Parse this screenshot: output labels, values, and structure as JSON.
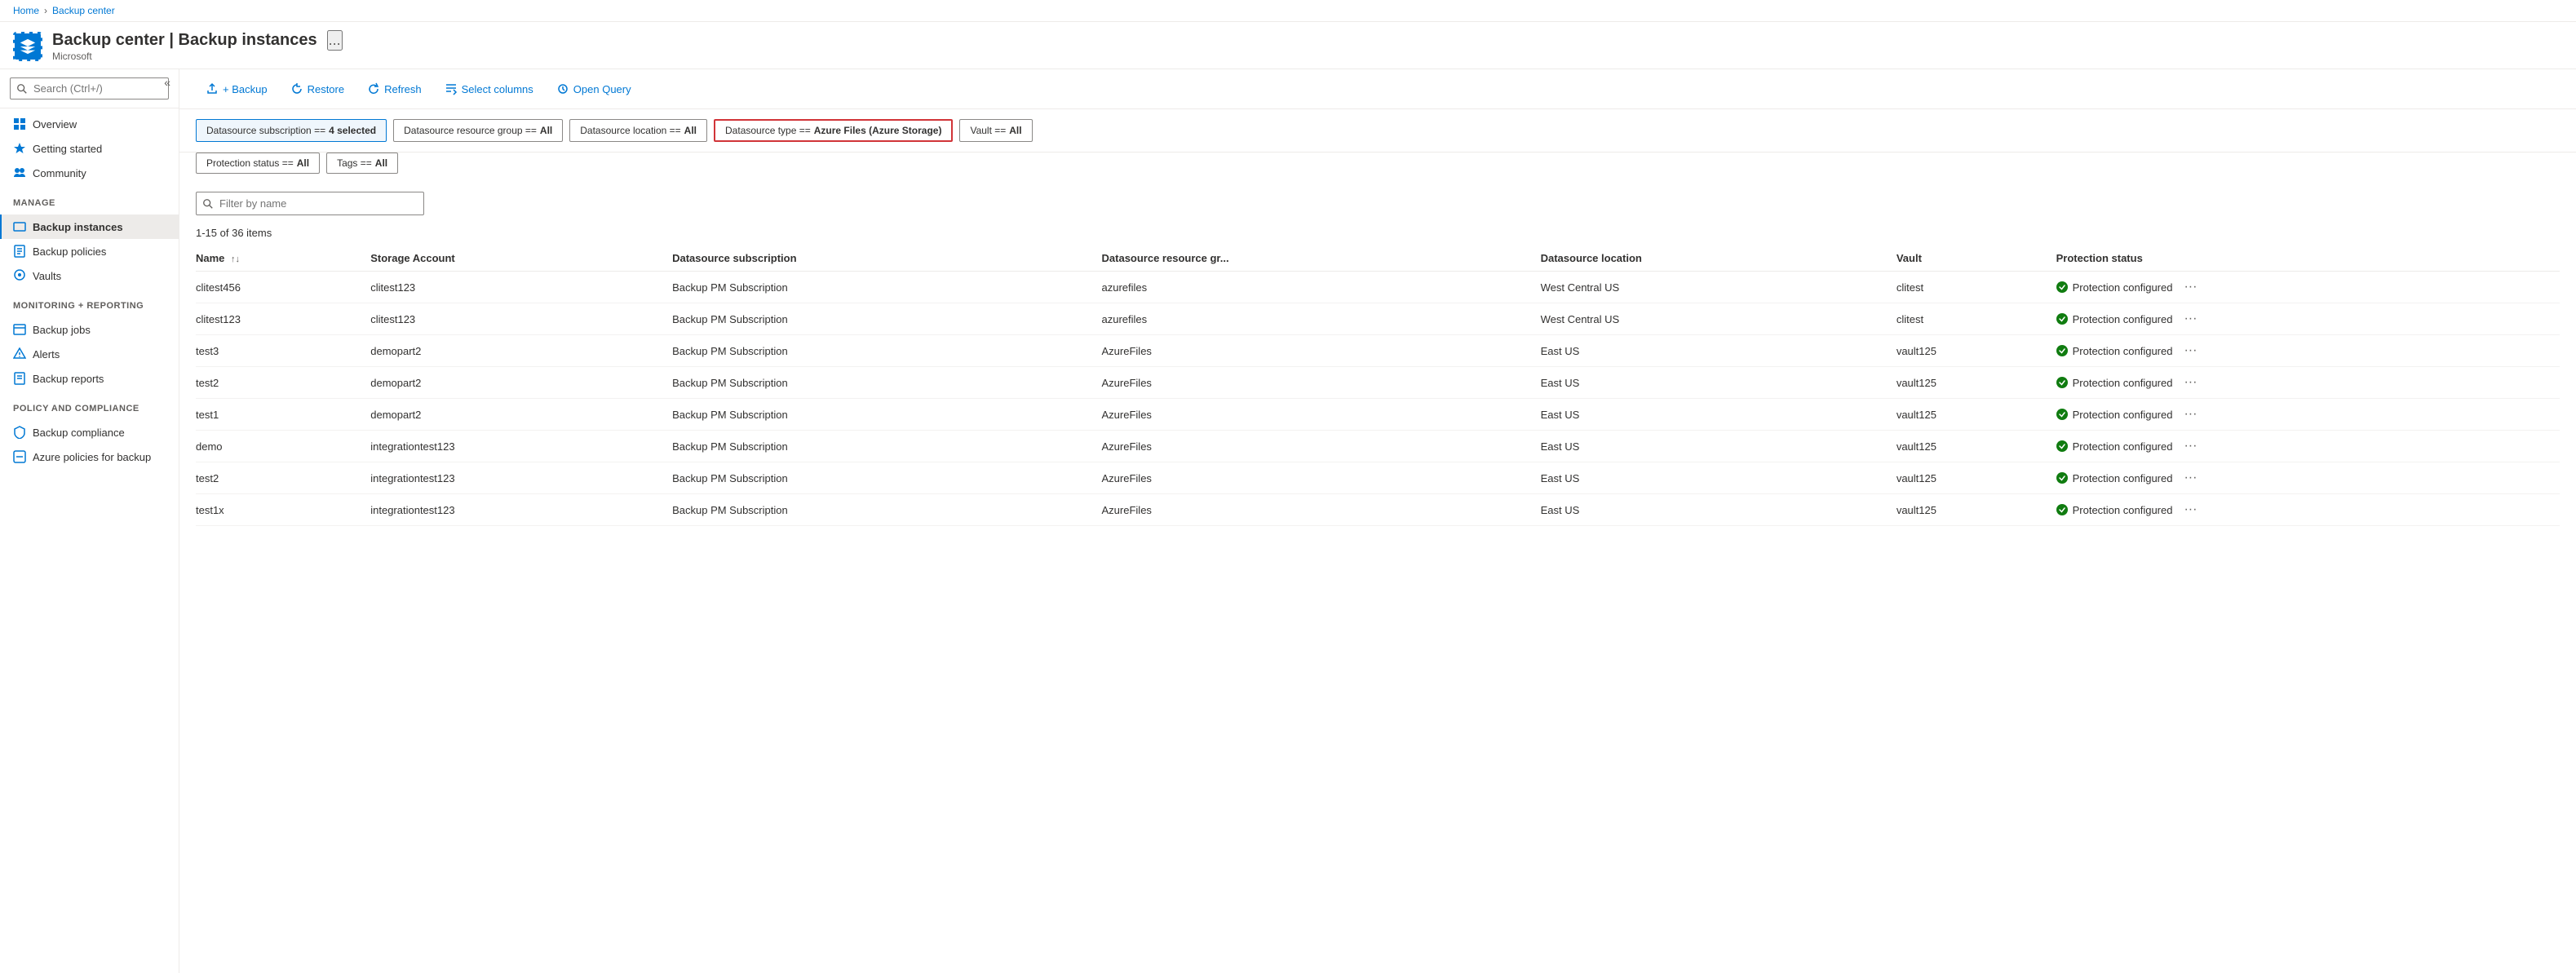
{
  "breadcrumb": {
    "home": "Home",
    "current": "Backup center"
  },
  "header": {
    "title": "Backup center | Backup instances",
    "subtitle": "Microsoft",
    "ellipsis": "..."
  },
  "sidebar": {
    "search_placeholder": "Search (Ctrl+/)",
    "collapse_label": "«",
    "items": [
      {
        "id": "overview",
        "label": "Overview",
        "icon": "overview"
      },
      {
        "id": "getting-started",
        "label": "Getting started",
        "icon": "getting-started"
      },
      {
        "id": "community",
        "label": "Community",
        "icon": "community"
      }
    ],
    "sections": [
      {
        "label": "Manage",
        "items": [
          {
            "id": "backup-instances",
            "label": "Backup instances",
            "icon": "backup-instances",
            "active": true
          },
          {
            "id": "backup-policies",
            "label": "Backup policies",
            "icon": "backup-policies"
          },
          {
            "id": "vaults",
            "label": "Vaults",
            "icon": "vaults"
          }
        ]
      },
      {
        "label": "Monitoring + reporting",
        "items": [
          {
            "id": "backup-jobs",
            "label": "Backup jobs",
            "icon": "backup-jobs"
          },
          {
            "id": "alerts",
            "label": "Alerts",
            "icon": "alerts"
          },
          {
            "id": "backup-reports",
            "label": "Backup reports",
            "icon": "backup-reports"
          }
        ]
      },
      {
        "label": "Policy and compliance",
        "items": [
          {
            "id": "backup-compliance",
            "label": "Backup compliance",
            "icon": "backup-compliance"
          },
          {
            "id": "azure-policies",
            "label": "Azure policies for backup",
            "icon": "azure-policies"
          }
        ]
      }
    ]
  },
  "toolbar": {
    "backup_label": "+ Backup",
    "restore_label": "Restore",
    "refresh_label": "Refresh",
    "select_columns_label": "Select columns",
    "open_query_label": "Open Query"
  },
  "filters": {
    "row1": [
      {
        "id": "datasource-subscription",
        "label": "Datasource subscription == ",
        "value": "4 selected",
        "active": true,
        "highlighted": false
      },
      {
        "id": "datasource-resource-group",
        "label": "Datasource resource group == ",
        "value": "All",
        "active": false,
        "highlighted": false
      },
      {
        "id": "datasource-location",
        "label": "Datasource location == ",
        "value": "All",
        "active": false,
        "highlighted": false
      },
      {
        "id": "datasource-type",
        "label": "Datasource type == ",
        "value": "Azure Files (Azure Storage)",
        "active": false,
        "highlighted": true
      }
    ],
    "row2": [
      {
        "id": "vault",
        "label": "Vault == ",
        "value": "All",
        "active": false,
        "highlighted": false
      },
      {
        "id": "protection-status",
        "label": "Protection status == ",
        "value": "All",
        "active": false,
        "highlighted": false
      },
      {
        "id": "tags",
        "label": "Tags == ",
        "value": "All",
        "active": false,
        "highlighted": false
      }
    ]
  },
  "table": {
    "search_placeholder": "Filter by name",
    "meta": "1-15 of 36 items",
    "columns": [
      {
        "id": "name",
        "label": "Name",
        "sortable": true
      },
      {
        "id": "storage-account",
        "label": "Storage Account",
        "sortable": false
      },
      {
        "id": "datasource-subscription",
        "label": "Datasource subscription",
        "sortable": false
      },
      {
        "id": "datasource-resource-group",
        "label": "Datasource resource gr...",
        "sortable": false
      },
      {
        "id": "datasource-location",
        "label": "Datasource location",
        "sortable": false
      },
      {
        "id": "vault",
        "label": "Vault",
        "sortable": false
      },
      {
        "id": "protection-status",
        "label": "Protection status",
        "sortable": false
      }
    ],
    "rows": [
      {
        "name": "clitest456",
        "storage_account": "clitest123",
        "subscription": "Backup PM Subscription",
        "resource_group": "azurefiles",
        "location": "West Central US",
        "vault": "clitest",
        "status": "Protection configured"
      },
      {
        "name": "clitest123",
        "storage_account": "clitest123",
        "subscription": "Backup PM Subscription",
        "resource_group": "azurefiles",
        "location": "West Central US",
        "vault": "clitest",
        "status": "Protection configured"
      },
      {
        "name": "test3",
        "storage_account": "demopart2",
        "subscription": "Backup PM Subscription",
        "resource_group": "AzureFiles",
        "location": "East US",
        "vault": "vault125",
        "status": "Protection configured"
      },
      {
        "name": "test2",
        "storage_account": "demopart2",
        "subscription": "Backup PM Subscription",
        "resource_group": "AzureFiles",
        "location": "East US",
        "vault": "vault125",
        "status": "Protection configured"
      },
      {
        "name": "test1",
        "storage_account": "demopart2",
        "subscription": "Backup PM Subscription",
        "resource_group": "AzureFiles",
        "location": "East US",
        "vault": "vault125",
        "status": "Protection configured"
      },
      {
        "name": "demo",
        "storage_account": "integrationtest123",
        "subscription": "Backup PM Subscription",
        "resource_group": "AzureFiles",
        "location": "East US",
        "vault": "vault125",
        "status": "Protection configured"
      },
      {
        "name": "test2",
        "storage_account": "integrationtest123",
        "subscription": "Backup PM Subscription",
        "resource_group": "AzureFiles",
        "location": "East US",
        "vault": "vault125",
        "status": "Protection configured"
      },
      {
        "name": "test1x",
        "storage_account": "integrationtest123",
        "subscription": "Backup PM Subscription",
        "resource_group": "AzureFiles",
        "location": "East US",
        "vault": "vault125",
        "status": "Protection configured"
      }
    ]
  },
  "colors": {
    "accent": "#0078d4",
    "success": "#107c10",
    "danger": "#d13438",
    "sidebar_active_bg": "#edebe9",
    "border": "#edebe9"
  }
}
